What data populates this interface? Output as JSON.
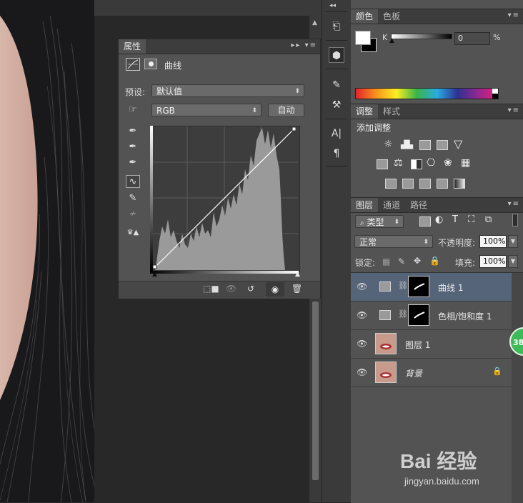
{
  "properties": {
    "tab_label": "属性",
    "panel_title": "曲线",
    "preset_label": "预设:",
    "preset_value": "默认值",
    "channel_value": "RGB",
    "auto_button": "自动"
  },
  "color_panel": {
    "tabs": [
      "颜色",
      "色板"
    ],
    "slider_label": "K",
    "value": "0",
    "unit": "%",
    "slider_level_percent": 0
  },
  "adjustments_panel": {
    "tabs": [
      "调整",
      "样式"
    ],
    "heading": "添加调整"
  },
  "layers_panel": {
    "tabs": [
      "图层",
      "通道",
      "路径"
    ],
    "filter_type": "类型",
    "blend_mode": "正常",
    "opacity_label": "不透明度:",
    "opacity_value": "100%",
    "lock_label": "锁定:",
    "fill_label": "填充:",
    "fill_value": "100%",
    "layers": [
      {
        "name": "曲线 1",
        "selected": true
      },
      {
        "name": "色相/饱和度 1",
        "selected": false
      },
      {
        "name": "图层 1",
        "selected": false
      },
      {
        "name": "背景",
        "selected": false
      }
    ]
  },
  "badge": {
    "text": "38"
  },
  "watermark": {
    "brand": "Bai 经验",
    "url": "jingyan.baidu.com"
  },
  "colors": {
    "panel_bg": "#535353",
    "selected_layer": "#56647a",
    "badge_green": "#3dbb5b"
  }
}
